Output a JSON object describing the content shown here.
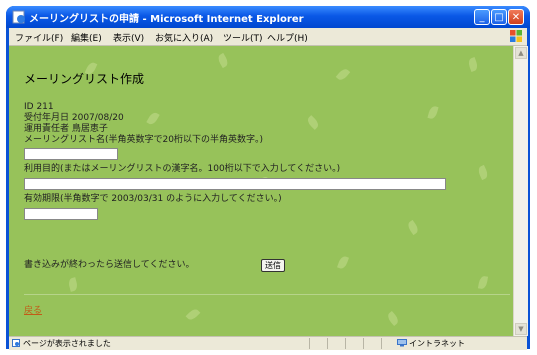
{
  "window": {
    "title": "メーリングリストの申請 - Microsoft Internet Explorer",
    "minimize": "_",
    "maximize": "□",
    "close": "✕"
  },
  "menu": [
    "ファイル(F)",
    "編集(E)",
    "表示(V)",
    "お気に入り(A)",
    "ツール(T)",
    "ヘルプ(H)"
  ],
  "page": {
    "title": "メーリングリスト作成",
    "id_line": "ID 211",
    "date_line": "受付年月日 2007/08/20",
    "admin_line": "運用責任者 鳥居恵子",
    "name_label": "メーリングリスト名(半角英数字で20桁以下の半角英数字。)",
    "name_value": "",
    "purpose_label": "利用目的(またはメーリングリストの漢字名。100桁以下で入力してください。)",
    "purpose_value": "",
    "expiry_label": "有効期限(半角数字で 2003/03/31 のように入力してください。)",
    "expiry_value": "",
    "instruction": "書き込みが終わったら送信してください。",
    "submit_label": "送信",
    "back_link": "戻る"
  },
  "status": {
    "text": "ページが表示されました",
    "zone": "イントラネット"
  },
  "colors": {
    "titlebar": "#0a58e6",
    "page_background": "#97c25a",
    "link": "#c25b17"
  }
}
